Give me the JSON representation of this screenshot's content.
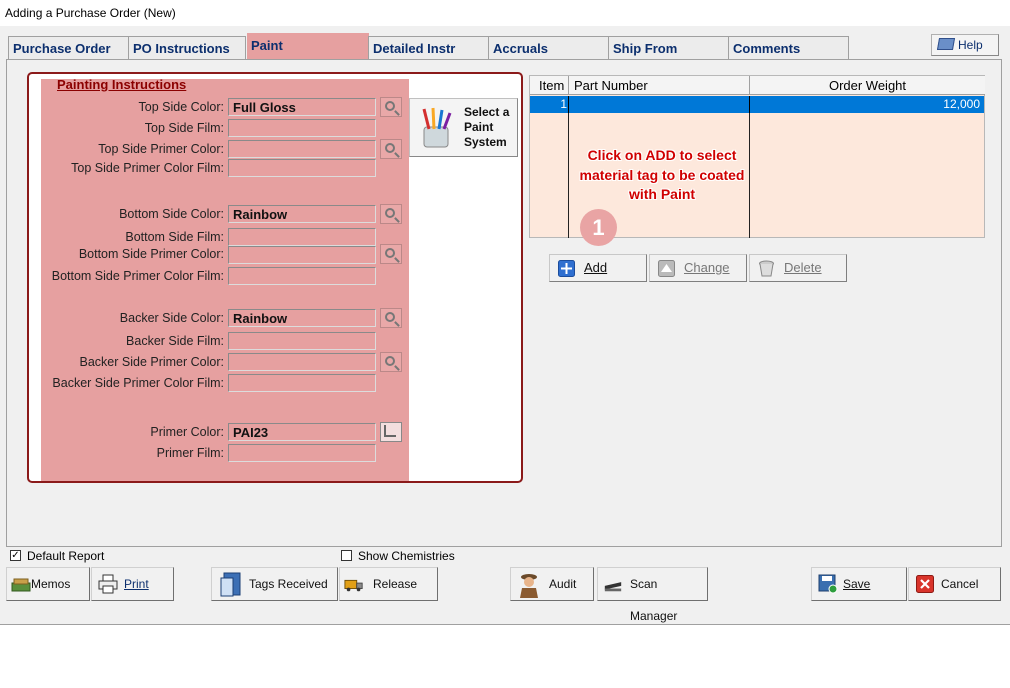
{
  "window": {
    "title": "Adding a Purchase Order  (New)"
  },
  "tabs": [
    {
      "label": "Purchase Order"
    },
    {
      "label": "PO Instructions"
    },
    {
      "label": "Paint"
    },
    {
      "label": "Detailed Instr"
    },
    {
      "label": "Accruals"
    },
    {
      "label": "Ship From"
    },
    {
      "label": "Comments"
    }
  ],
  "help": {
    "label": "Help"
  },
  "paint": {
    "section_title": "Painting Instructions",
    "select_paint_system": "Select a Paint System",
    "select_paint_system_lines": [
      "Select a",
      "Paint",
      "System"
    ],
    "fields": {
      "top_side_color": {
        "label": "Top Side Color:",
        "value": "Full Gloss"
      },
      "top_side_film": {
        "label": "Top Side Film:",
        "value": ""
      },
      "top_side_primer_color": {
        "label": "Top Side Primer Color:",
        "value": ""
      },
      "top_side_primer_color_film": {
        "label": "Top Side Primer Color Film:",
        "value": ""
      },
      "bottom_side_color": {
        "label": "Bottom Side Color:",
        "value": "Rainbow"
      },
      "bottom_side_film": {
        "label": "Bottom Side Film:",
        "value": ""
      },
      "bottom_side_primer_color": {
        "label": "Bottom Side Primer Color:",
        "value": ""
      },
      "bottom_side_primer_color_film": {
        "label": "Bottom Side Primer Color Film:",
        "value": ""
      },
      "backer_side_color": {
        "label": "Backer Side Color:",
        "value": "Rainbow"
      },
      "backer_side_film": {
        "label": "Backer Side Film:",
        "value": ""
      },
      "backer_side_primer_color": {
        "label": "Backer Side Primer Color:",
        "value": ""
      },
      "backer_side_primer_color_film": {
        "label": "Backer Side Primer Color Film:",
        "value": ""
      },
      "primer_color": {
        "label": "Primer Color:",
        "value": "PAI23"
      },
      "primer_film": {
        "label": "Primer Film:",
        "value": ""
      }
    }
  },
  "grid": {
    "columns": [
      "Item",
      "Part Number",
      "Order Weight"
    ],
    "rows": [
      {
        "item": "1",
        "part_number": "",
        "order_weight": "12,000"
      }
    ]
  },
  "callout": {
    "lines": [
      "Click on ADD to select",
      "material tag to be coated",
      "with Paint"
    ],
    "step": "1"
  },
  "grid_buttons": {
    "add": "Add",
    "change": "Change",
    "delete": "Delete"
  },
  "options": {
    "default_report": "Default Report",
    "default_report_checked": true,
    "show_chemistries": "Show Chemistries",
    "show_chemistries_checked": false
  },
  "bottom_buttons": {
    "memos": "Memos",
    "print": "Print",
    "tags_received": "Tags Received",
    "release": "Release",
    "audit": "Audit",
    "scan_manager": "Scan Manager",
    "save": "Save",
    "cancel": "Cancel"
  },
  "colors": {
    "accent_pink": "#e6a0a0",
    "frame_red": "#8b1a1a",
    "tab_text": "#0c2f6e",
    "selection_blue": "#0078d7",
    "callout_red": "#d00000"
  }
}
